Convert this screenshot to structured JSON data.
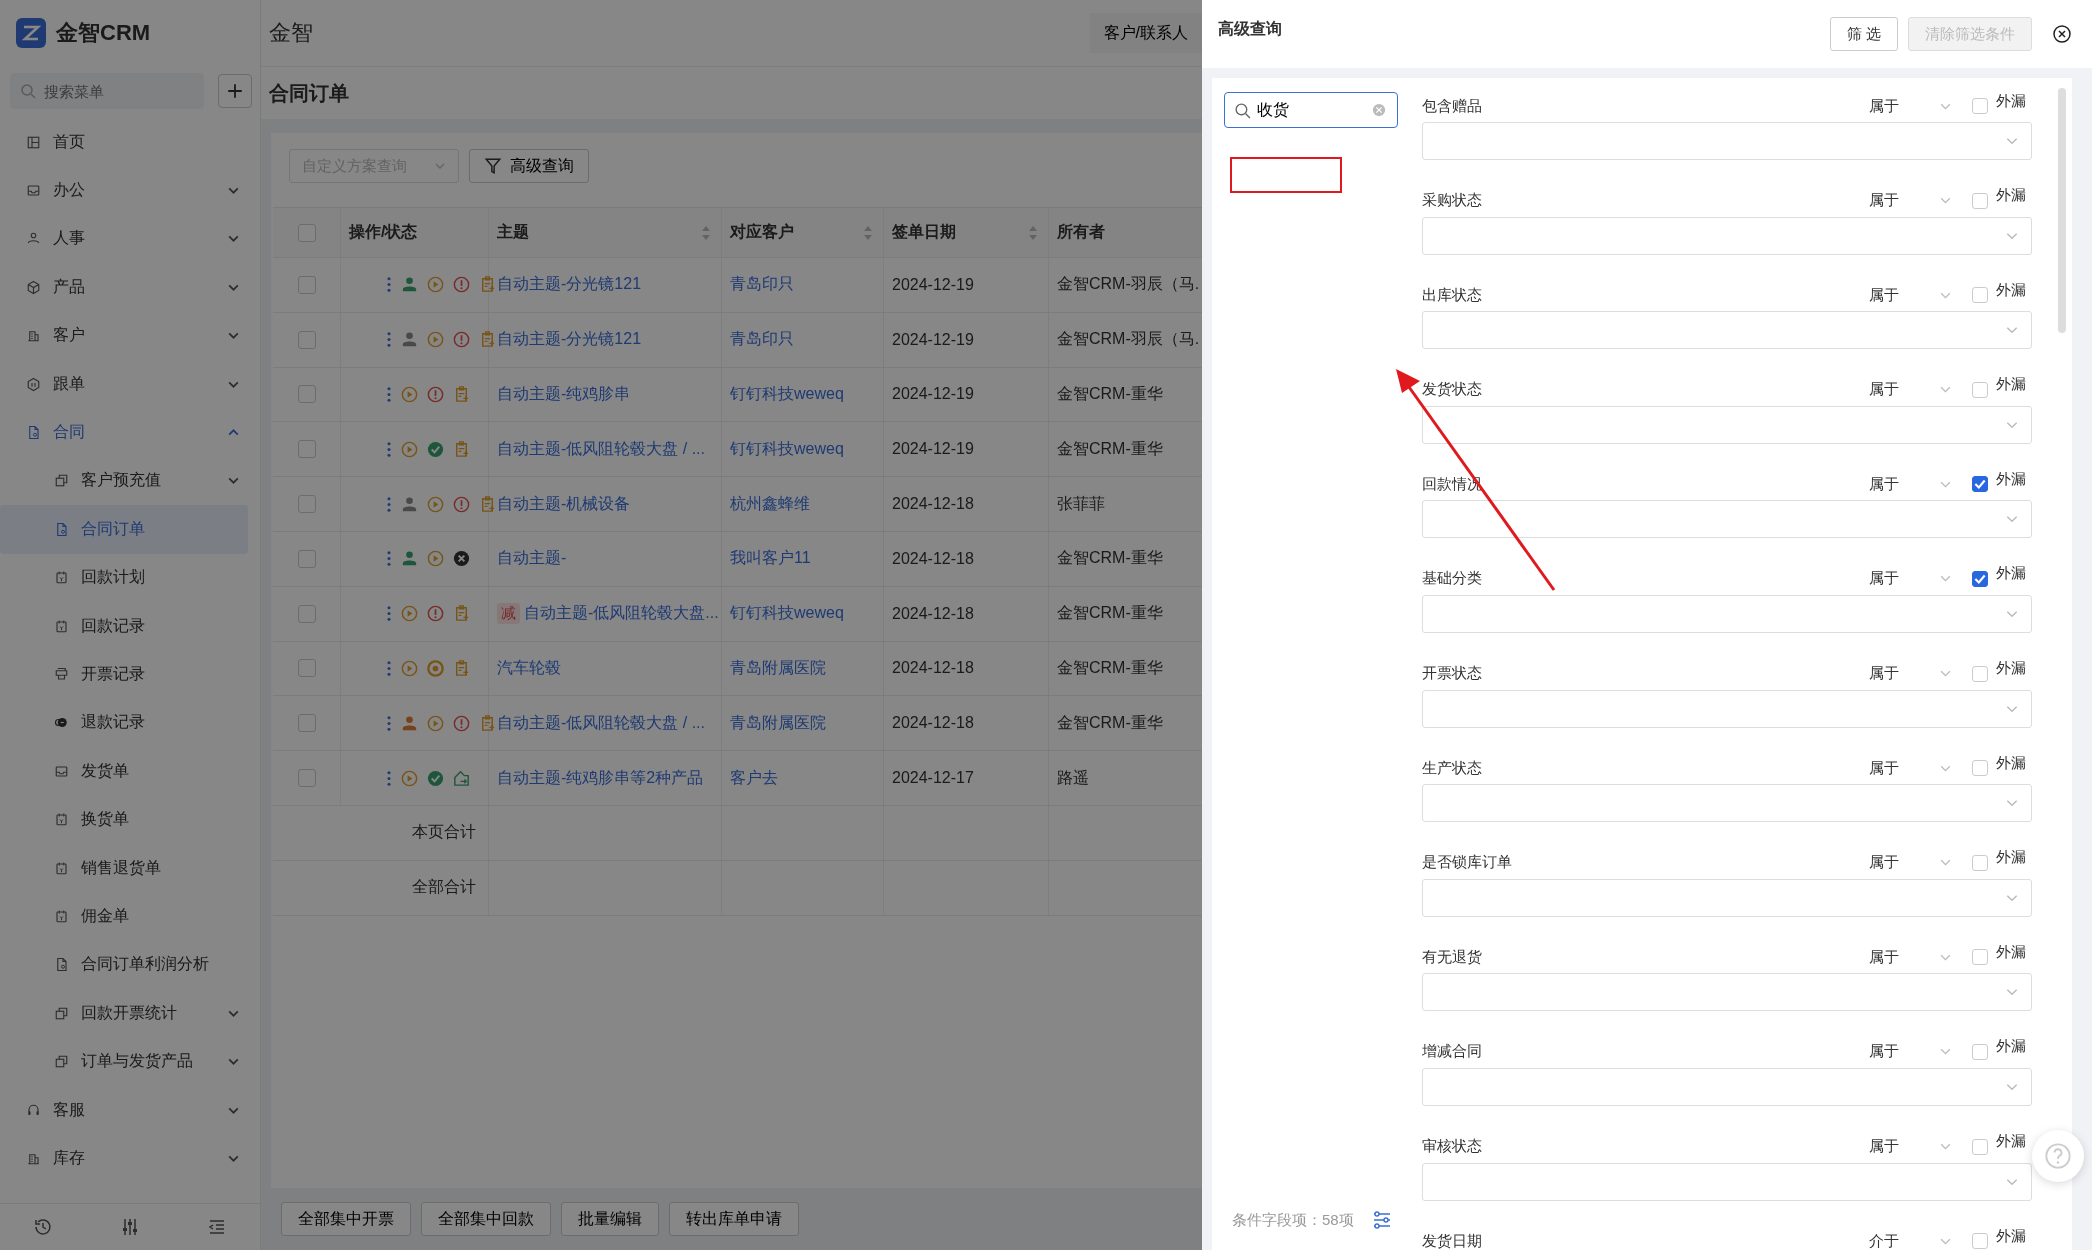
{
  "sidebar": {
    "logo": "金智CRM",
    "search_placeholder": "搜索菜单",
    "items": [
      {
        "label": "首页",
        "selected": false
      },
      {
        "label": "办公",
        "selected": false,
        "expanded": false
      },
      {
        "label": "人事",
        "selected": false,
        "expanded": false
      },
      {
        "label": "产品",
        "selected": false,
        "expanded": false
      },
      {
        "label": "客户",
        "selected": false,
        "expanded": false
      },
      {
        "label": "跟单",
        "selected": false,
        "expanded": false
      },
      {
        "label": "合同",
        "selected": false,
        "expanded": true,
        "children": [
          {
            "label": "客户预充值",
            "selected": false,
            "expanded": false
          },
          {
            "label": "合同订单",
            "selected": true
          },
          {
            "label": "回款计划",
            "selected": false
          },
          {
            "label": "回款记录",
            "selected": false
          },
          {
            "label": "开票记录",
            "selected": false
          },
          {
            "label": "退款记录",
            "selected": false
          },
          {
            "label": "发货单",
            "selected": false
          },
          {
            "label": "换货单",
            "selected": false
          },
          {
            "label": "销售退货单",
            "selected": false
          },
          {
            "label": "佣金单",
            "selected": false
          },
          {
            "label": "合同订单利润分析",
            "selected": false
          },
          {
            "label": "回款开票统计",
            "selected": false,
            "expanded": false
          },
          {
            "label": "订单与发货产品",
            "selected": false,
            "expanded": false
          }
        ]
      },
      {
        "label": "客服",
        "selected": false,
        "expanded": false
      },
      {
        "label": "库存",
        "selected": false,
        "expanded": false
      }
    ]
  },
  "topbar": {
    "title": "金智",
    "button": "客户/联系人"
  },
  "page": {
    "title": "合同订单",
    "scheme_placeholder": "自定义方案查询",
    "advanced_button": "高级查询"
  },
  "table": {
    "select_all": {
      "checked": false
    },
    "columns": [
      "操作/状态",
      "主题",
      "对应客户",
      "签单日期",
      "所有者"
    ],
    "rows": [
      {
        "checked": false,
        "icons": [
          {
            "kind": "person",
            "color": "#1f563c"
          },
          {
            "kind": "play"
          },
          {
            "kind": "alert"
          },
          {
            "kind": "clipboard"
          }
        ],
        "subject": "自动主题-分光镜121",
        "customer": "青岛印只",
        "date": "2024-12-19",
        "owner": "金智CRM-羽辰（马."
      },
      {
        "checked": false,
        "icons": [
          {
            "kind": "person",
            "color": "#494949"
          },
          {
            "kind": "play"
          },
          {
            "kind": "alert"
          },
          {
            "kind": "clipboard"
          }
        ],
        "subject": "自动主题-分光镜121",
        "customer": "青岛印只",
        "date": "2024-12-19",
        "owner": "金智CRM-羽辰（马."
      },
      {
        "checked": false,
        "icons": [
          {
            "kind": "play"
          },
          {
            "kind": "alert"
          },
          {
            "kind": "clipboard"
          }
        ],
        "subject": "自动主题-纯鸡胗串",
        "customer": "钉钉科技weweq",
        "date": "2024-12-19",
        "owner": "金智CRM-重华"
      },
      {
        "checked": false,
        "icons": [
          {
            "kind": "play"
          },
          {
            "kind": "check"
          },
          {
            "kind": "clipboard"
          }
        ],
        "subject": "自动主题-低风阻轮毂大盘 / ...",
        "customer": "钉钉科技weweq",
        "date": "2024-12-19",
        "owner": "金智CRM-重华"
      },
      {
        "checked": false,
        "icons": [
          {
            "kind": "person",
            "color": "#494949"
          },
          {
            "kind": "play"
          },
          {
            "kind": "alert"
          },
          {
            "kind": "clipboard"
          }
        ],
        "subject": "自动主题-机械设备",
        "customer": "杭州鑫蜂维",
        "date": "2024-12-18",
        "owner": "张菲菲"
      },
      {
        "checked": false,
        "icons": [
          {
            "kind": "person",
            "color": "#1f563c"
          },
          {
            "kind": "play"
          },
          {
            "kind": "cancel"
          }
        ],
        "subject": "自动主题-",
        "customer": "我叫客户11",
        "date": "2024-12-18",
        "owner": "金智CRM-重华"
      },
      {
        "checked": false,
        "icons": [
          {
            "kind": "play"
          },
          {
            "kind": "alert"
          },
          {
            "kind": "clipboard"
          }
        ],
        "tag": "减",
        "subject": "自动主题-低风阻轮毂大盘...",
        "customer": "钉钉科技weweq",
        "date": "2024-12-18",
        "owner": "金智CRM-重华"
      },
      {
        "checked": false,
        "icons": [
          {
            "kind": "play"
          },
          {
            "kind": "coin"
          },
          {
            "kind": "clipboard"
          }
        ],
        "subject": "汽车轮毂",
        "customer": "青岛附属医院",
        "date": "2024-12-18",
        "owner": "金智CRM-重华"
      },
      {
        "checked": false,
        "icons": [
          {
            "kind": "person",
            "color": "#77411e"
          },
          {
            "kind": "play"
          },
          {
            "kind": "alert"
          },
          {
            "kind": "clipboard"
          }
        ],
        "subject": "自动主题-低风阻轮毂大盘 / ...",
        "customer": "青岛附属医院",
        "date": "2024-12-18",
        "owner": "金智CRM-重华"
      },
      {
        "checked": false,
        "icons": [
          {
            "kind": "play"
          },
          {
            "kind": "check"
          },
          {
            "kind": "share"
          }
        ],
        "subject": "自动主题-纯鸡胗串等2种产品",
        "customer": "客户去",
        "date": "2024-12-17",
        "owner": "路遥"
      }
    ],
    "totals": [
      "本页合计",
      "全部合计"
    ]
  },
  "bottom_buttons": [
    "全部集中开票",
    "全部集中回款",
    "批量编辑",
    "转出库单申请"
  ],
  "drawer": {
    "title": "高级查询",
    "filter_button": "筛 选",
    "clear_button": {
      "label": "清除筛选条件",
      "disabled": true
    },
    "search": {
      "value": "收货"
    },
    "field_count": "条件字段项：58项",
    "fields": [
      {
        "label": "包含赠品",
        "operator": "属于",
        "exclude_label": "外漏",
        "exclude": false
      },
      {
        "label": "采购状态",
        "operator": "属于",
        "exclude_label": "外漏",
        "exclude": false
      },
      {
        "label": "出库状态",
        "operator": "属于",
        "exclude_label": "外漏",
        "exclude": false
      },
      {
        "label": "发货状态",
        "operator": "属于",
        "exclude_label": "外漏",
        "exclude": false
      },
      {
        "label": "回款情况",
        "operator": "属于",
        "exclude_label": "外漏",
        "exclude": true
      },
      {
        "label": "基础分类",
        "operator": "属于",
        "exclude_label": "外漏",
        "exclude": true
      },
      {
        "label": "开票状态",
        "operator": "属于",
        "exclude_label": "外漏",
        "exclude": false
      },
      {
        "label": "生产状态",
        "operator": "属于",
        "exclude_label": "外漏",
        "exclude": false
      },
      {
        "label": "是否锁库订单",
        "operator": "属于",
        "exclude_label": "外漏",
        "exclude": false
      },
      {
        "label": "有无退货",
        "operator": "属于",
        "exclude_label": "外漏",
        "exclude": false
      },
      {
        "label": "增减合同",
        "operator": "属于",
        "exclude_label": "外漏",
        "exclude": false
      },
      {
        "label": "审核状态",
        "operator": "属于",
        "exclude_label": "外漏",
        "exclude": false
      },
      {
        "label": "发货日期",
        "operator": "介于",
        "exclude_label": "外漏",
        "exclude": false
      }
    ]
  }
}
